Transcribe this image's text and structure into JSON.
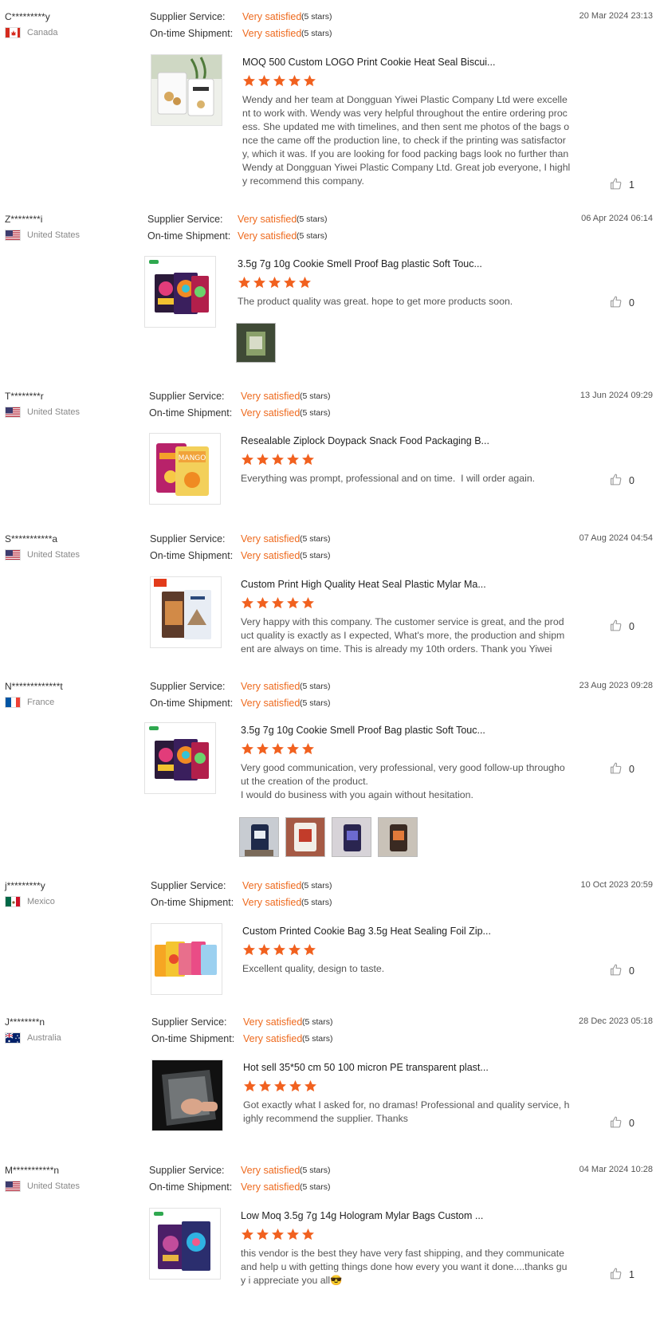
{
  "labels": {
    "supplier_service": "Supplier Service:",
    "ontime_shipment": "On-time Shipment:",
    "very_satisfied": "Very satisfied",
    "five_stars": "(5 stars)"
  },
  "colors": {
    "accent": "#ee6a1e",
    "text": "#333333",
    "muted": "#888888"
  },
  "reviews": [
    {
      "user": "C*********y",
      "country": "Canada",
      "flag": "canada",
      "date": "20 Mar 2024 23:13",
      "product": "MOQ 500 Custom LOGO Print Cookie Heat Seal Biscui...",
      "text": "Wendy and her team at Dongguan Yiwei Plastic Company Ltd were excellent to work with. Wendy was very helpful throughout the entire ordering process. She updated me with timelines, and then sent me photos of the bags once the came off the production line, to check if the printing was satisfactory, which it was. If you are looking for food packing bags look no further than Wendy at Dongguan Yiwei Plastic Company Ltd. Great job everyone, I highly recommend this company.",
      "likes": "1"
    },
    {
      "user": "Z********i",
      "country": "United States",
      "flag": "usa",
      "date": "06 Apr 2024 06:14",
      "product": "3.5g 7g 10g Cookie Smell Proof Bag plastic Soft Touc...",
      "text": "The product quality was great. hope to get more products soon.",
      "likes": "0"
    },
    {
      "user": "T********r",
      "country": "United States",
      "flag": "usa",
      "date": "13 Jun 2024 09:29",
      "product": "Resealable Ziplock Doypack Snack Food Packaging B...",
      "text": "Everything was prompt, professional and on time.  I will order again.",
      "likes": "0"
    },
    {
      "user": "S***********a",
      "country": "United States",
      "flag": "usa",
      "date": "07 Aug 2024 04:54",
      "product": "Custom Print High Quality Heat Seal Plastic Mylar Ma...",
      "text": "Very happy with this company. The customer service is great, and the product quality is exactly as I expected, What's more, the production and shipment are always on time. This is already my 10th orders. Thank you Yiwei",
      "likes": "0"
    },
    {
      "user": "N*************t",
      "country": "France",
      "flag": "france",
      "date": "23 Aug 2023 09:28",
      "product": "3.5g 7g 10g Cookie Smell Proof Bag plastic Soft Touc...",
      "text": "Very good communication, very professional, very good follow-up throughout the creation of the product.\nI would do business with you again without hesitation.",
      "likes": "0"
    },
    {
      "user": "j*********y",
      "country": "Mexico",
      "flag": "mexico",
      "date": "10 Oct 2023 20:59",
      "product": "Custom Printed Cookie Bag 3.5g Heat Sealing Foil Zip...",
      "text": "Excellent quality, design to taste.",
      "likes": "0"
    },
    {
      "user": "J********n",
      "country": "Australia",
      "flag": "australia",
      "date": "28 Dec 2023 05:18",
      "product": "Hot sell 35*50 cm 50 100 micron PE transparent plast...",
      "text": "Got exactly what I asked for, no dramas! Professional and quality service, highly recommend the supplier. Thanks",
      "likes": "0"
    },
    {
      "user": "M***********n",
      "country": "United States",
      "flag": "usa",
      "date": "04 Mar 2024 10:28",
      "product": "Low Moq 3.5g 7g 14g Hologram Mylar Bags Custom ...",
      "text": "this vendor is the best they have very fast shipping, and they communicate and help u with getting things done how every you want it done....thanks guy i appreciate you all😎",
      "likes": "1"
    }
  ]
}
